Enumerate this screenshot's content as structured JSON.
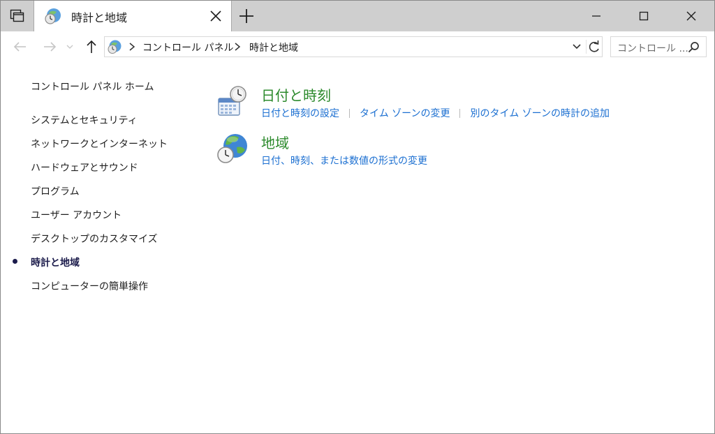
{
  "tab": {
    "title": "時計と地域"
  },
  "address": {
    "crumbs": [
      "コントロール パネル",
      "時計と地域"
    ],
    "search_placeholder": "コントロール ..."
  },
  "sidebar": {
    "items": [
      {
        "label": "コントロール パネル ホーム"
      },
      {
        "label": "システムとセキュリティ"
      },
      {
        "label": "ネットワークとインターネット"
      },
      {
        "label": "ハードウェアとサウンド"
      },
      {
        "label": "プログラム"
      },
      {
        "label": "ユーザー アカウント"
      },
      {
        "label": "デスクトップのカスタマイズ"
      },
      {
        "label": "時計と地域",
        "current": true
      },
      {
        "label": "コンピューターの簡単操作"
      }
    ]
  },
  "categories": [
    {
      "title": "日付と時刻",
      "links": [
        "日付と時刻の設定",
        "タイム ゾーンの変更",
        "別のタイム ゾーンの時計の追加"
      ],
      "icon": "calendar-clock-icon"
    },
    {
      "title": "地域",
      "links": [
        "日付、時刻、または数値の形式の変更"
      ],
      "icon": "globe-clock-icon"
    }
  ],
  "colors": {
    "category_title": "#2c8a2c",
    "link": "#1b6fd1",
    "titlebar": "#cfcfcf"
  }
}
